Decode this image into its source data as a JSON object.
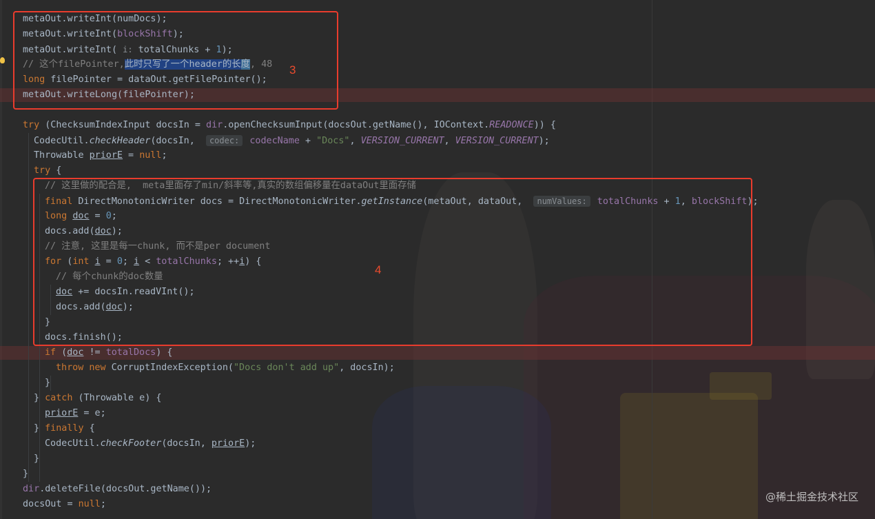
{
  "editor": {
    "lines": [
      {
        "x": 33,
        "tokens": [
          {
            "t": "metaOut.writeInt(numDocs);"
          }
        ]
      },
      {
        "x": 33,
        "tokens": [
          {
            "t": "metaOut.writeInt("
          },
          {
            "t": "blockShift",
            "c": "fld"
          },
          {
            "t": ");"
          }
        ]
      },
      {
        "x": 33,
        "tokens": [
          {
            "t": "metaOut.writeInt( "
          },
          {
            "t": "i:",
            "c": "hint-plain"
          },
          {
            "t": " totalChunks + ",
            "c": "fld-plain"
          },
          {
            "t": "1",
            "c": "num"
          },
          {
            "t": ");"
          }
        ]
      },
      {
        "x": 33,
        "tokens": [
          {
            "t": "// 这个filePointer,",
            "c": "cm"
          },
          {
            "t": "此时只写了一个header的长",
            "c": "sel"
          },
          {
            "t": "度",
            "c": "caret"
          },
          {
            "t": ", 48",
            "c": "cm"
          }
        ]
      },
      {
        "x": 33,
        "tokens": [
          {
            "t": "long",
            "c": "kw"
          },
          {
            "t": " filePointer = dataOut.getFilePointer();"
          }
        ]
      },
      {
        "x": 33,
        "tokens": [
          {
            "t": "metaOut.writeLong(filePointer);"
          }
        ]
      },
      {
        "x": 33,
        "tokens": [
          {
            "t": ""
          }
        ]
      },
      {
        "x": 33,
        "tokens": [
          {
            "t": "try",
            "c": "kw"
          },
          {
            "t": " (ChecksumIndexInput docsIn = "
          },
          {
            "t": "dir",
            "c": "fld"
          },
          {
            "t": ".openChecksumInput(docsOut.getName(), IOContext."
          },
          {
            "t": "READONCE",
            "c": "fld-i"
          },
          {
            "t": ")) {"
          }
        ]
      },
      {
        "x": 49,
        "tokens": [
          {
            "t": "CodecUtil."
          },
          {
            "t": "checkHeader",
            "c": "call-i"
          },
          {
            "t": "(docsIn,  "
          },
          {
            "t": "codec:",
            "c": "hint"
          },
          {
            "t": " codecName",
            "c": "fld"
          },
          {
            "t": " + "
          },
          {
            "t": "\"Docs\"",
            "c": "str"
          },
          {
            "t": ", "
          },
          {
            "t": "VERSION_CURRENT",
            "c": "fld-i"
          },
          {
            "t": ", "
          },
          {
            "t": "VERSION_CURRENT",
            "c": "fld-i"
          },
          {
            "t": ");"
          }
        ]
      },
      {
        "x": 49,
        "tokens": [
          {
            "t": "Throwable "
          },
          {
            "t": "priorE",
            "c": "ul"
          },
          {
            "t": " = "
          },
          {
            "t": "null",
            "c": "kw"
          },
          {
            "t": ";"
          }
        ]
      },
      {
        "x": 49,
        "tokens": [
          {
            "t": "try",
            "c": "kw"
          },
          {
            "t": " {"
          }
        ]
      },
      {
        "x": 65,
        "tokens": [
          {
            "t": "// 这里做的配合是,  meta里面存了min/斜率等,真实的数组偏移量在dataOut里面存储",
            "c": "cm"
          }
        ]
      },
      {
        "x": 65,
        "tokens": [
          {
            "t": "final",
            "c": "kw"
          },
          {
            "t": " DirectMonotonicWriter docs = DirectMonotonicWriter."
          },
          {
            "t": "getInstance",
            "c": "call-i"
          },
          {
            "t": "(metaOut, dataOut,  "
          },
          {
            "t": "numValues:",
            "c": "hint"
          },
          {
            "t": " totalChunks",
            "c": "fld"
          },
          {
            "t": " + "
          },
          {
            "t": "1",
            "c": "num"
          },
          {
            "t": ", "
          },
          {
            "t": "blockShift",
            "c": "fld"
          },
          {
            "t": ");"
          }
        ]
      },
      {
        "x": 65,
        "tokens": [
          {
            "t": "long",
            "c": "kw"
          },
          {
            "t": " "
          },
          {
            "t": "doc",
            "c": "ul"
          },
          {
            "t": " = "
          },
          {
            "t": "0",
            "c": "num"
          },
          {
            "t": ";"
          }
        ]
      },
      {
        "x": 65,
        "tokens": [
          {
            "t": "docs.add("
          },
          {
            "t": "doc",
            "c": "ul"
          },
          {
            "t": ");"
          }
        ]
      },
      {
        "x": 65,
        "tokens": [
          {
            "t": "// 注意, 这里是每一chunk, 而不是per document",
            "c": "cm"
          }
        ]
      },
      {
        "x": 65,
        "tokens": [
          {
            "t": "for",
            "c": "kw"
          },
          {
            "t": " ("
          },
          {
            "t": "int",
            "c": "kw"
          },
          {
            "t": " "
          },
          {
            "t": "i",
            "c": "ul"
          },
          {
            "t": " = "
          },
          {
            "t": "0",
            "c": "num"
          },
          {
            "t": "; "
          },
          {
            "t": "i",
            "c": "ul"
          },
          {
            "t": " < "
          },
          {
            "t": "totalChunks",
            "c": "fld"
          },
          {
            "t": "; ++"
          },
          {
            "t": "i",
            "c": "ul"
          },
          {
            "t": ") {"
          }
        ]
      },
      {
        "x": 81,
        "tokens": [
          {
            "t": "// 每个chunk的doc数量",
            "c": "cm"
          }
        ]
      },
      {
        "x": 81,
        "tokens": [
          {
            "t": "doc",
            "c": "ul"
          },
          {
            "t": " += docsIn.readVInt();"
          }
        ]
      },
      {
        "x": 81,
        "tokens": [
          {
            "t": "docs.add("
          },
          {
            "t": "doc",
            "c": "ul"
          },
          {
            "t": ");"
          }
        ]
      },
      {
        "x": 65,
        "tokens": [
          {
            "t": "}"
          }
        ]
      },
      {
        "x": 65,
        "tokens": [
          {
            "t": "docs.finish();"
          }
        ]
      },
      {
        "x": 65,
        "tokens": [
          {
            "t": "if",
            "c": "kw"
          },
          {
            "t": " ("
          },
          {
            "t": "doc",
            "c": "ul"
          },
          {
            "t": " != "
          },
          {
            "t": "totalDocs",
            "c": "fld"
          },
          {
            "t": ") {"
          }
        ]
      },
      {
        "x": 81,
        "tokens": [
          {
            "t": "throw",
            "c": "kw"
          },
          {
            "t": " "
          },
          {
            "t": "new",
            "c": "kw"
          },
          {
            "t": " CorruptIndexException("
          },
          {
            "t": "\"Docs don't add up\"",
            "c": "str"
          },
          {
            "t": ", docsIn);"
          }
        ]
      },
      {
        "x": 65,
        "tokens": [
          {
            "t": "}"
          }
        ]
      },
      {
        "x": 49,
        "tokens": [
          {
            "t": "} "
          },
          {
            "t": "catch",
            "c": "kw"
          },
          {
            "t": " (Throwable e) {"
          }
        ]
      },
      {
        "x": 65,
        "tokens": [
          {
            "t": "priorE",
            "c": "ul"
          },
          {
            "t": " = e;"
          }
        ]
      },
      {
        "x": 49,
        "tokens": [
          {
            "t": "} "
          },
          {
            "t": "finally",
            "c": "kw"
          },
          {
            "t": " {"
          }
        ]
      },
      {
        "x": 65,
        "tokens": [
          {
            "t": "CodecUtil."
          },
          {
            "t": "checkFooter",
            "c": "call-i"
          },
          {
            "t": "(docsIn, "
          },
          {
            "t": "priorE",
            "c": "ul"
          },
          {
            "t": ");"
          }
        ]
      },
      {
        "x": 49,
        "tokens": [
          {
            "t": "}"
          }
        ]
      },
      {
        "x": 33,
        "tokens": [
          {
            "t": "}"
          }
        ]
      },
      {
        "x": 33,
        "tokens": [
          {
            "t": "dir",
            "c": "fld"
          },
          {
            "t": ".deleteFile(docsOut.getName());"
          }
        ]
      },
      {
        "x": 33,
        "tokens": [
          {
            "t": "docsOut = "
          },
          {
            "t": "null",
            "c": "kw"
          },
          {
            "t": ";"
          }
        ]
      }
    ]
  },
  "annotations": {
    "label_3": "3",
    "label_4": "4"
  },
  "watermark": "@稀土掘金技术社区",
  "colors": {
    "background": "#2b2b2b",
    "default_text": "#a9b7c6",
    "keyword": "#cc7832",
    "string": "#6a8759",
    "number": "#6897bb",
    "comment": "#808080",
    "field": "#9876aa",
    "selection": "#214283",
    "annotation_red": "#ea3c2d"
  }
}
